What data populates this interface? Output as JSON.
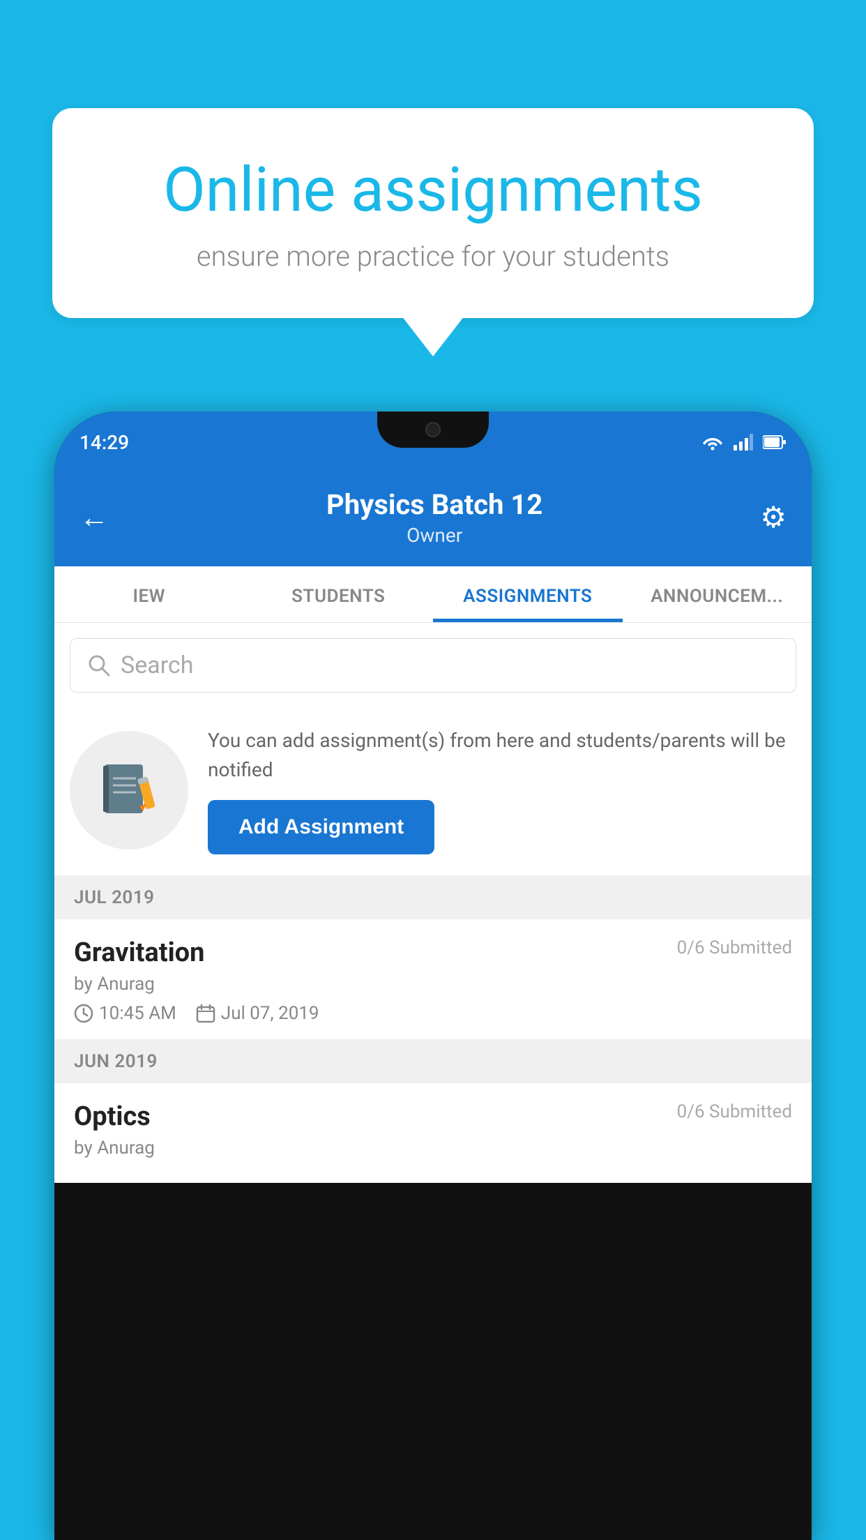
{
  "background_color": "#1ab8e8",
  "speech_bubble": {
    "title": "Online assignments",
    "subtitle": "ensure more practice for your students"
  },
  "phone": {
    "status_bar": {
      "time": "14:29",
      "icons": [
        "wifi",
        "signal",
        "battery"
      ]
    },
    "header": {
      "title": "Physics Batch 12",
      "subtitle": "Owner",
      "back_label": "←",
      "gear_label": "⚙"
    },
    "tabs": [
      {
        "label": "IEW",
        "active": false
      },
      {
        "label": "STUDENTS",
        "active": false
      },
      {
        "label": "ASSIGNMENTS",
        "active": true
      },
      {
        "label": "ANNOUNCEM...",
        "active": false
      }
    ],
    "search": {
      "placeholder": "Search"
    },
    "promo": {
      "description": "You can add assignment(s) from here and students/parents will be notified",
      "add_button_label": "Add Assignment"
    },
    "sections": [
      {
        "label": "JUL 2019",
        "assignments": [
          {
            "name": "Gravitation",
            "submitted": "0/6 Submitted",
            "author": "by Anurag",
            "time": "10:45 AM",
            "date": "Jul 07, 2019"
          }
        ]
      },
      {
        "label": "JUN 2019",
        "assignments": [
          {
            "name": "Optics",
            "submitted": "0/6 Submitted",
            "author": "by Anurag",
            "time": "",
            "date": ""
          }
        ]
      }
    ]
  }
}
